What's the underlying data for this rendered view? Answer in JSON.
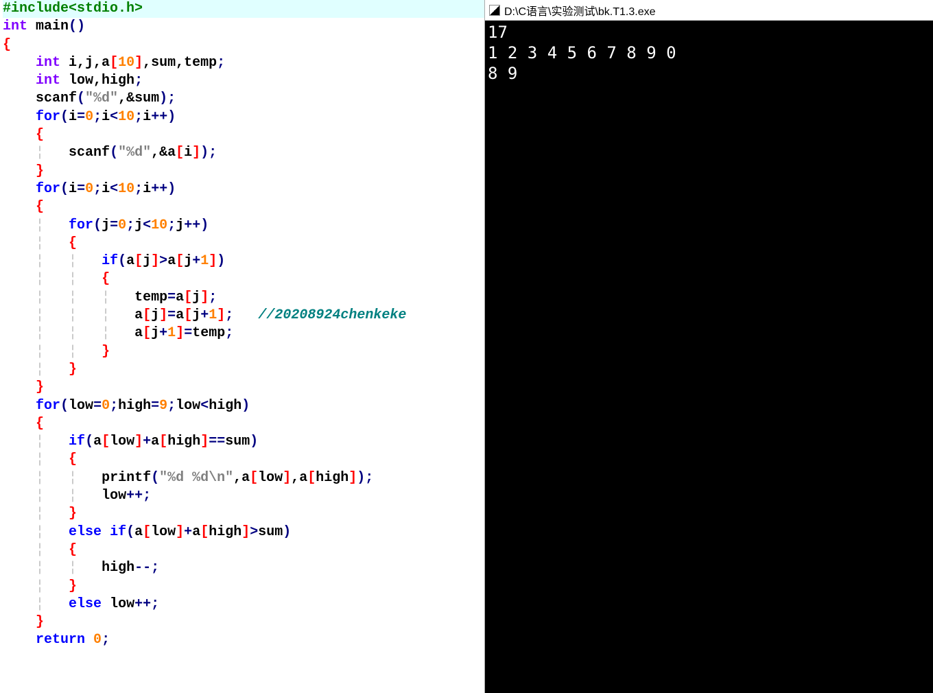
{
  "code": {
    "include": "#include<stdio.h>",
    "int": "int",
    "main": "main",
    "lp": "(",
    "rp": ")",
    "lb": "{",
    "rb": "}",
    "lbr": "[",
    "rbr": "]",
    "semi": ";",
    "comma": ",",
    "vars": "i,j,a",
    "ten": "10",
    "sumtemp": ",sum,temp",
    "lowhigh": "low,high",
    "scanf": "scanf",
    "fmt_d": "\"%d\"",
    "amp_sum": ",&sum",
    "for": "for",
    "i_eq": "i",
    "eq": "=",
    "zero": "0",
    "lt": "<",
    "pp": "++",
    "amp_ai": ",&a",
    "i": "i",
    "j": "j",
    "j_eq": "j",
    "if": "if",
    "a": "a",
    "gt": ">",
    "plus": "+",
    "one": "1",
    "temp": "temp",
    "comment": "//20208924chenkeke",
    "low": "low",
    "high": "high",
    "nine": "9",
    "eqeq": "==",
    "sum": "sum",
    "printf": "printf",
    "fmt_dd": "\"%d %d\\n\"",
    "comma_a": ",a",
    "else": "else",
    "mm": "--",
    "return": "return",
    "sp": " "
  },
  "console": {
    "title": "D:\\C语言\\实验测试\\bk.T1.3.exe",
    "line1": "17",
    "line2": "1 2 3 4 5 6 7 8 9 0",
    "line3": "8 9"
  }
}
